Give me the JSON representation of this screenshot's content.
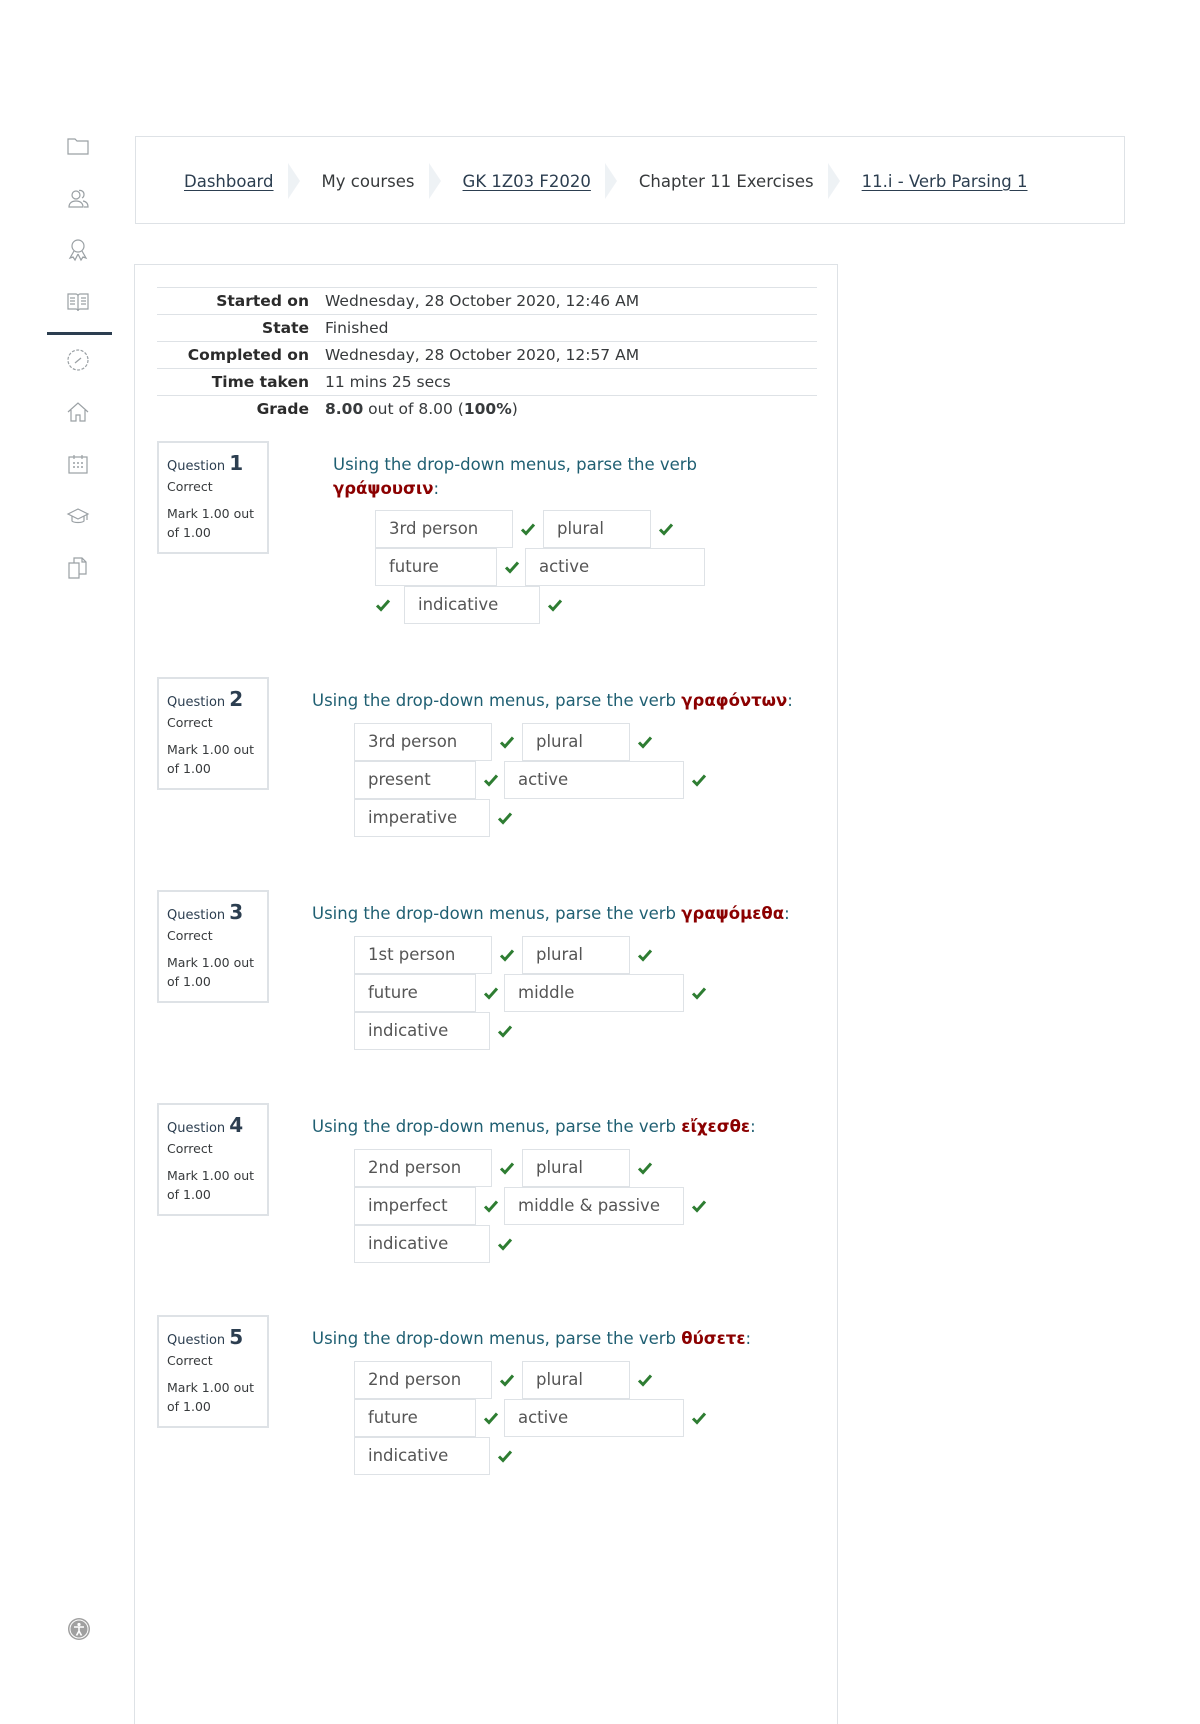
{
  "sidebar": {
    "icons": [
      "folder-icon",
      "users-icon",
      "badge-icon",
      "book-icon",
      "dashboard-gauge-icon",
      "home-icon",
      "calendar-icon",
      "graduation-cap-icon",
      "files-icon"
    ],
    "accessibility_icon": "accessibility-icon"
  },
  "breadcrumb": [
    {
      "label": "Dashboard",
      "link": true
    },
    {
      "label": "My courses",
      "link": false
    },
    {
      "label": "GK 1Z03 F2020",
      "link": true
    },
    {
      "label": "Chapter 11 Exercises",
      "link": false
    },
    {
      "label": "11.i - Verb Parsing 1",
      "link": true
    }
  ],
  "summary": {
    "started_label": "Started on",
    "started_value": "Wednesday, 28 October 2020, 12:46 AM",
    "state_label": "State",
    "state_value": "Finished",
    "completed_label": "Completed on",
    "completed_value": "Wednesday, 28 October 2020, 12:57 AM",
    "time_label": "Time taken",
    "time_value": "11 mins 25 secs",
    "grade_label": "Grade",
    "grade_score": "8.00",
    "grade_mid": " out of 8.00 (",
    "grade_percent": "100%",
    "grade_end": ")"
  },
  "questions": [
    {
      "word": "Question",
      "number": "1",
      "status": "Correct",
      "mark": "Mark 1.00 out of 1.00",
      "prompt": "Using the drop-down menus, parse the verb ",
      "verb": "γράψουσιν",
      "suffix": ":",
      "answers": [
        "3rd person",
        "plural",
        "future",
        "active",
        "indicative"
      ]
    },
    {
      "word": "Question",
      "number": "2",
      "status": "Correct",
      "mark": "Mark 1.00 out of 1.00",
      "prompt": "Using the drop-down menus, parse the verb ",
      "verb": "γραφόντων",
      "suffix": ":",
      "answers": [
        "3rd person",
        "plural",
        "present",
        "active",
        "imperative"
      ]
    },
    {
      "word": "Question",
      "number": "3",
      "status": "Correct",
      "mark": "Mark 1.00 out of 1.00",
      "prompt": "Using the drop-down menus, parse the verb ",
      "verb": "γραψόμεθα",
      "suffix": ":",
      "answers": [
        "1st person",
        "plural",
        "future",
        "middle",
        "indicative"
      ]
    },
    {
      "word": "Question",
      "number": "4",
      "status": "Correct",
      "mark": "Mark 1.00 out of 1.00",
      "prompt": "Using the drop-down menus, parse the verb ",
      "verb": "εἴχεσθε",
      "suffix": ":",
      "answers": [
        "2nd person",
        "plural",
        "imperfect",
        "middle & passive",
        "indicative"
      ]
    },
    {
      "word": "Question",
      "number": "5",
      "status": "Correct",
      "mark": "Mark 1.00 out of 1.00",
      "prompt": "Using the drop-down menus, parse the verb ",
      "verb": "θύσετε",
      "suffix": ":",
      "answers": [
        "2nd person",
        "plural",
        "future",
        "active",
        "indicative"
      ]
    }
  ],
  "colors": {
    "correct_check": "#2e7d32",
    "verb": "#8b0000",
    "prompt": "#1f5f72"
  }
}
